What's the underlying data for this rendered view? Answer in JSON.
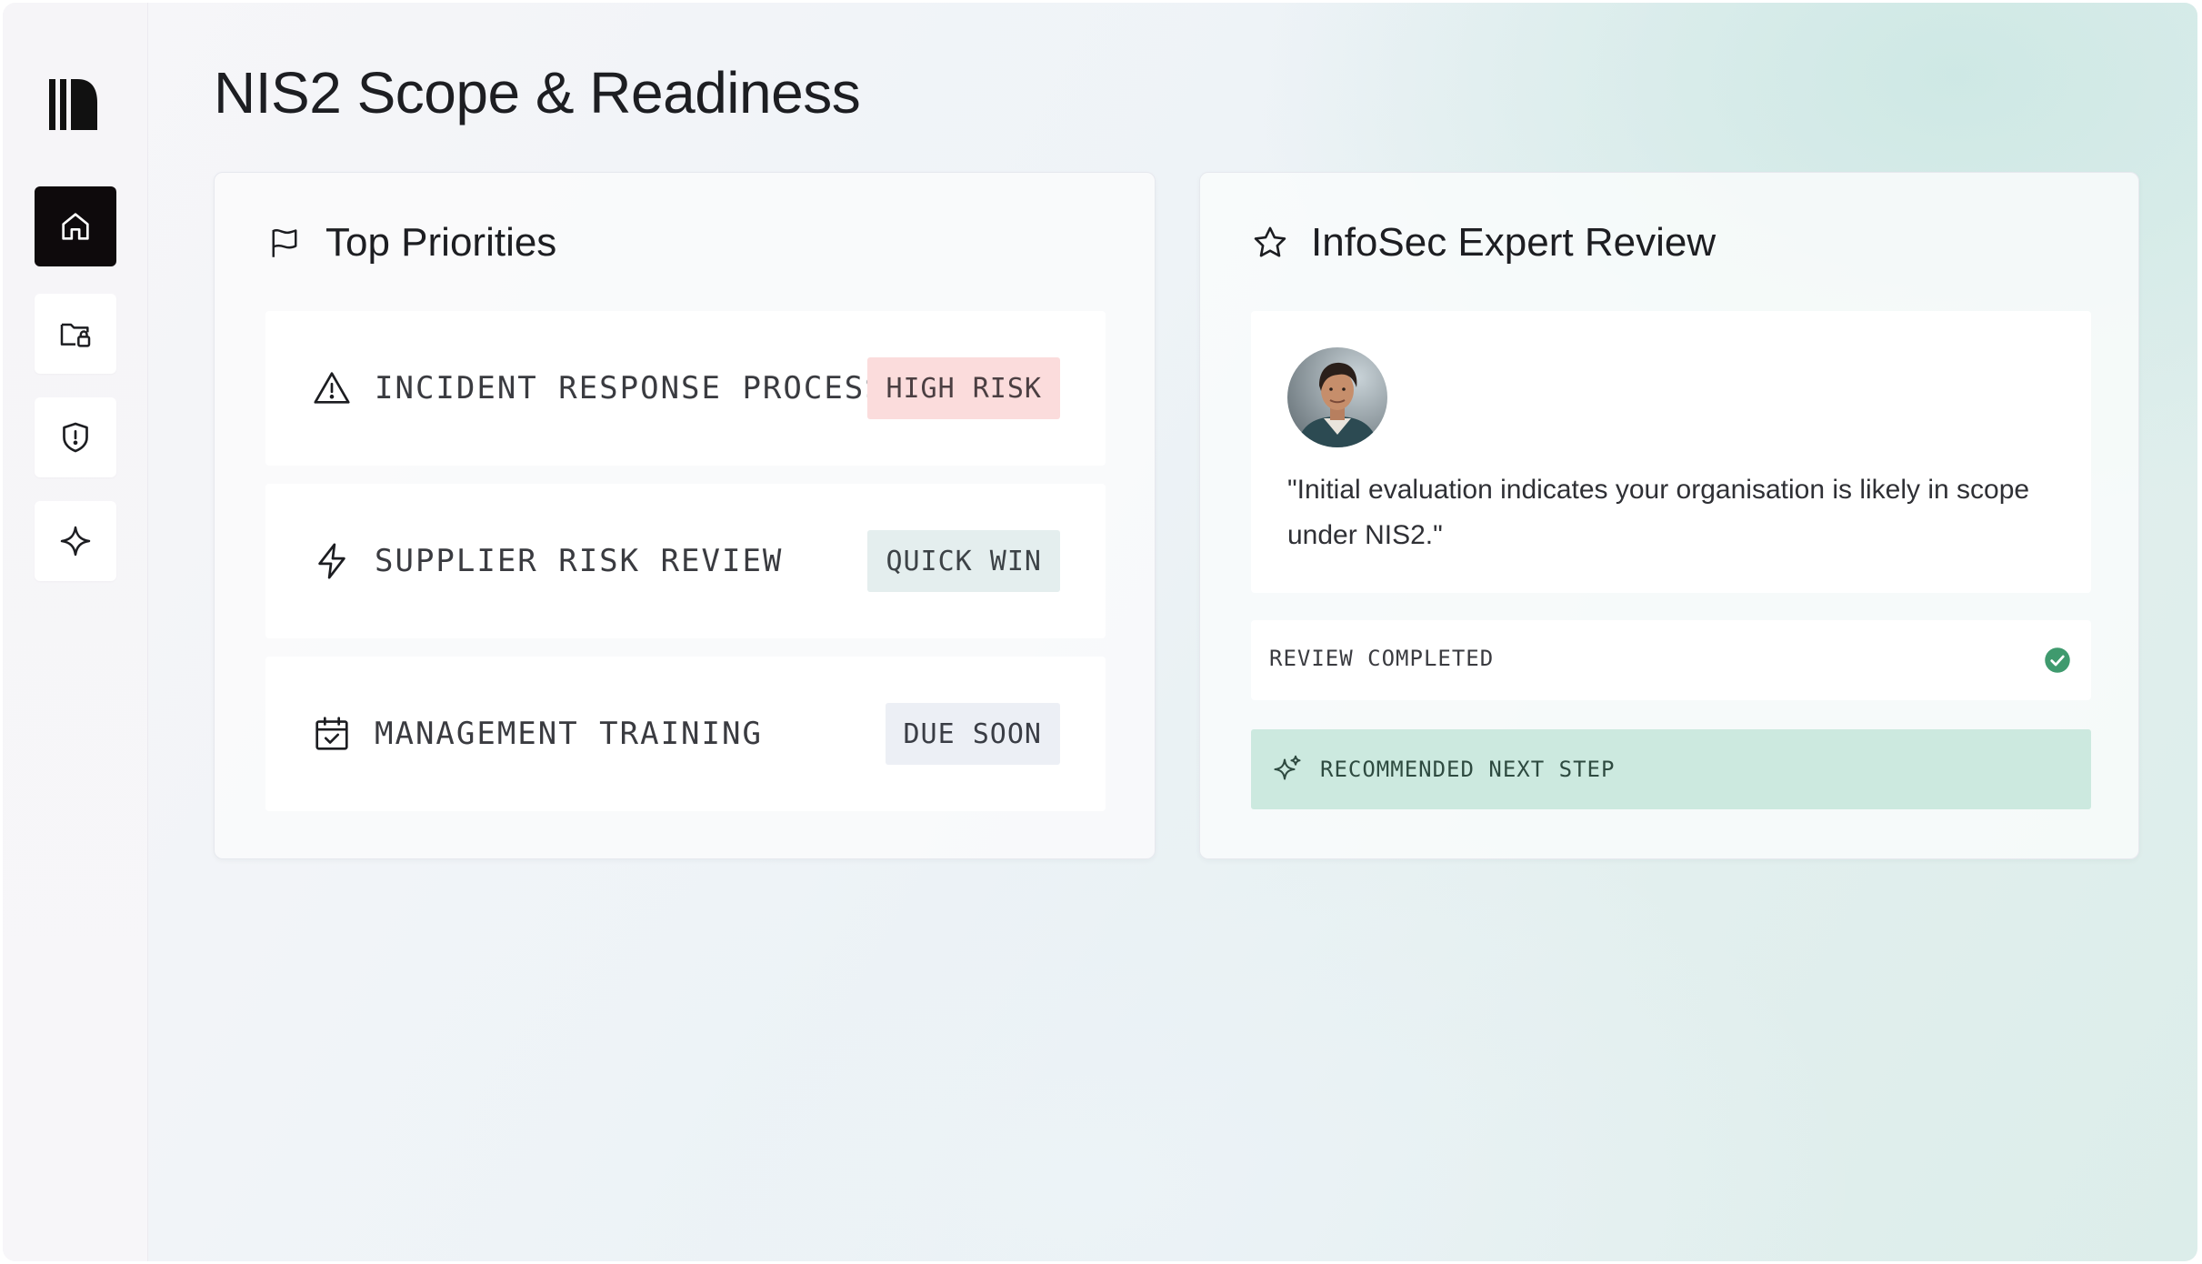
{
  "page": {
    "title": "NIS2 Scope & Readiness"
  },
  "sidebar": {
    "items": [
      {
        "name": "home",
        "icon": "home-icon",
        "active": true
      },
      {
        "name": "secure-folder",
        "icon": "folder-lock-icon",
        "active": false
      },
      {
        "name": "security",
        "icon": "shield-alert-icon",
        "active": false
      },
      {
        "name": "ai",
        "icon": "sparkle-icon",
        "active": false
      }
    ]
  },
  "priorities": {
    "title": "Top Priorities",
    "icon": "flag-icon",
    "items": [
      {
        "label": "INCIDENT RESPONSE PROCESS",
        "badge": "HIGH RISK",
        "icon": "warning-triangle-icon"
      },
      {
        "label": "SUPPLIER RISK REVIEW",
        "badge": "QUICK WIN",
        "icon": "lightning-icon"
      },
      {
        "label": "MANAGEMENT TRAINING",
        "badge": "DUE SOON",
        "icon": "calendar-check-icon"
      }
    ]
  },
  "review": {
    "title": "InfoSec Expert Review",
    "icon": "star-icon",
    "quote": "\"Initial evaluation indicates your organisation is likely in scope under NIS2.\"",
    "status": "REVIEW COMPLETED",
    "next_step": "RECOMMENDED NEXT STEP"
  },
  "colors": {
    "accent_dark": "#0e0a0c",
    "high_risk_bg": "#fbdcdc",
    "success": "#3f9a6e",
    "next_step_bg": "#cce9df"
  }
}
